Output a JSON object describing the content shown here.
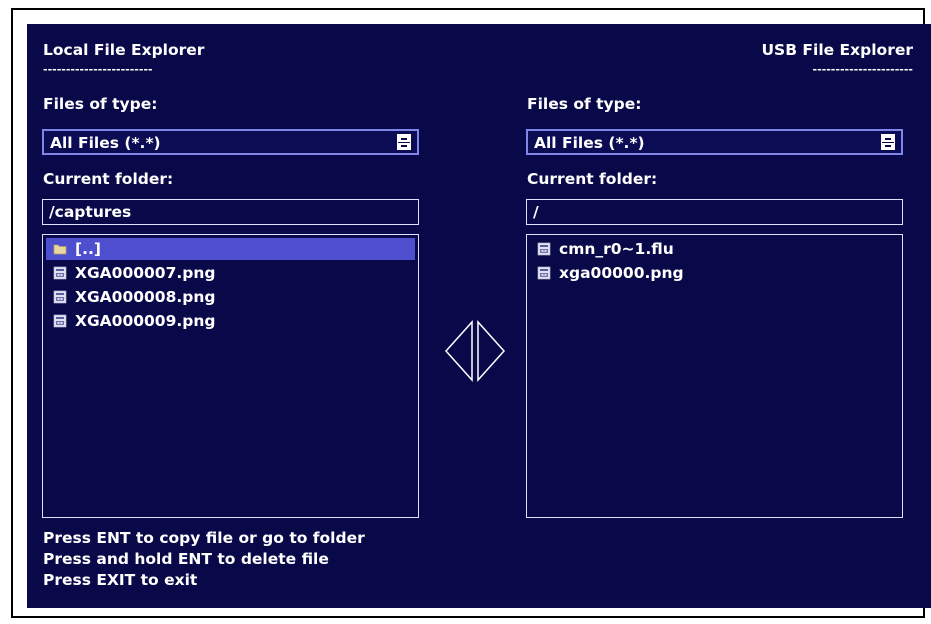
{
  "local": {
    "title": "Local File Explorer",
    "underline": "------------------------",
    "files_of_type_label": "Files of type:",
    "files_of_type_value": "All Files (*.*)",
    "current_folder_label": "Current folder:",
    "current_folder_value": "/captures",
    "items": [
      {
        "name": "[..]",
        "icon": "folder-icon",
        "selected": true
      },
      {
        "name": "XGA000007.png",
        "icon": "file-icon",
        "selected": false
      },
      {
        "name": "XGA000008.png",
        "icon": "file-icon",
        "selected": false
      },
      {
        "name": "XGA000009.png",
        "icon": "file-icon",
        "selected": false
      }
    ]
  },
  "usb": {
    "title": "USB File Explorer",
    "underline": "----------------------",
    "files_of_type_label": "Files of type:",
    "files_of_type_value": "All Files (*.*)",
    "current_folder_label": "Current folder:",
    "current_folder_value": "/",
    "items": [
      {
        "name": "cmn_r0~1.flu",
        "icon": "file-icon",
        "selected": false
      },
      {
        "name": "xga00000.png",
        "icon": "file-icon",
        "selected": false
      }
    ]
  },
  "instructions": [
    "Press ENT to copy file or go to folder",
    "Press and hold ENT to delete file",
    "Press EXIT to exit"
  ],
  "colors": {
    "background": "#09094a",
    "selection": "#4d4fcf",
    "text": "#ffffff",
    "select_border": "#7f86e8"
  }
}
